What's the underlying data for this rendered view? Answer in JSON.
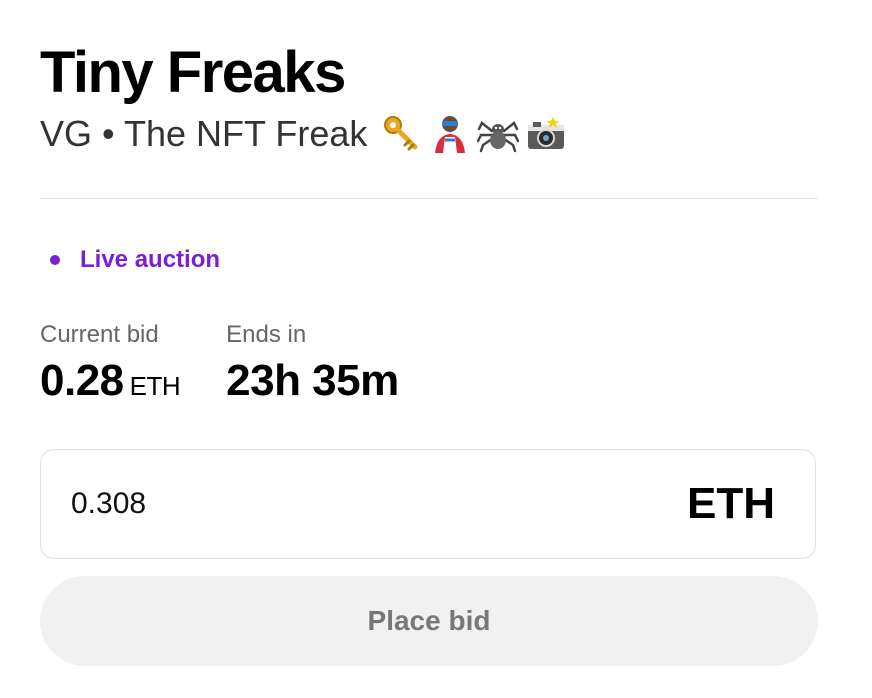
{
  "header": {
    "title": "Tiny Freaks",
    "subtitle": "VG • The NFT Freak",
    "subtitle_emojis": [
      "key-icon",
      "superhero-icon",
      "spider-icon",
      "camera-flash-icon"
    ]
  },
  "auction": {
    "status_label": "Live auction",
    "status_color": "#7b1fd6"
  },
  "stats": {
    "current_bid_label": "Current bid",
    "current_bid_value": "0.28",
    "current_bid_unit": "ETH",
    "ends_in_label": "Ends in",
    "ends_in_value": "23h 35m"
  },
  "bid_form": {
    "input_value": "0.308",
    "currency": "ETH",
    "button_label": "Place bid"
  }
}
